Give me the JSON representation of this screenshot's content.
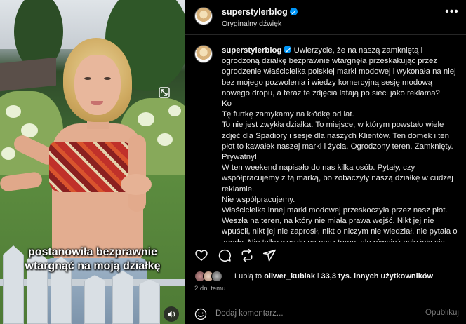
{
  "video": {
    "caption_line1": "postanowiła bezprawnie",
    "caption_line2": "wtargnąć na moją działkę"
  },
  "header": {
    "username": "superstylerblog",
    "audio_label": "Oryginalny dźwięk",
    "more_icon": "more-horizontal-icon"
  },
  "post": {
    "username": "superstylerblog",
    "caption": "Uwierzycie, że na naszą zamkniętą i ogrodzoną działkę bezprawnie wtargnęła przeskakując przez ogrodzenie właścicielka polskiej marki modowej i wykonała na niej bez mojego pozwolenia i wiedzy komercyjną sesję modową nowego dropu, a teraz te zdjęcia latają po sieci jako reklama?\nKo\nTę furtkę zamykamy na kłódkę od lat.\nTo nie jest zwykła działka. To miejsce, w którym powstało wiele zdjęć dla Spadiory i sesje dla naszych Klientów. Ten domek i ten płot to kawałek naszej marki i życia. Ogrodzony teren. Zamknięty. Prywatny!\nW ten weekend napisało do nas kilka osób. Pytały, czy współpracujemy z tą marką, bo zobaczyły naszą działkę w cudzej reklamie.\nNie współpracujemy.\nWłaścicielka innej marki modowej przeskoczyła przez nasz płot. Weszła na teren, na który nie miała prawa wejść. Nikt jej nie wpuścił, nikt jej nie zaprosił, nikt o niczym nie wiedział, nie pytała o zgodę. Nie tylko weszła na nasz teren, ale również położyła się"
  },
  "actions": [
    "heart-icon",
    "comment-icon",
    "share-icon",
    "send-icon"
  ],
  "likes": {
    "prefix": "Lubią to ",
    "user": "oliwer_kubiak",
    "middle": " i ",
    "count": "33,3 tys. innych użytkowników"
  },
  "time": "2 dni temu",
  "add_comment": {
    "placeholder": "Dodaj komentarz...",
    "post_label": "Opublikuj"
  },
  "colors": {
    "background": "#000000",
    "verified": "#0095f6",
    "secondary_text": "#a8a8a8"
  }
}
